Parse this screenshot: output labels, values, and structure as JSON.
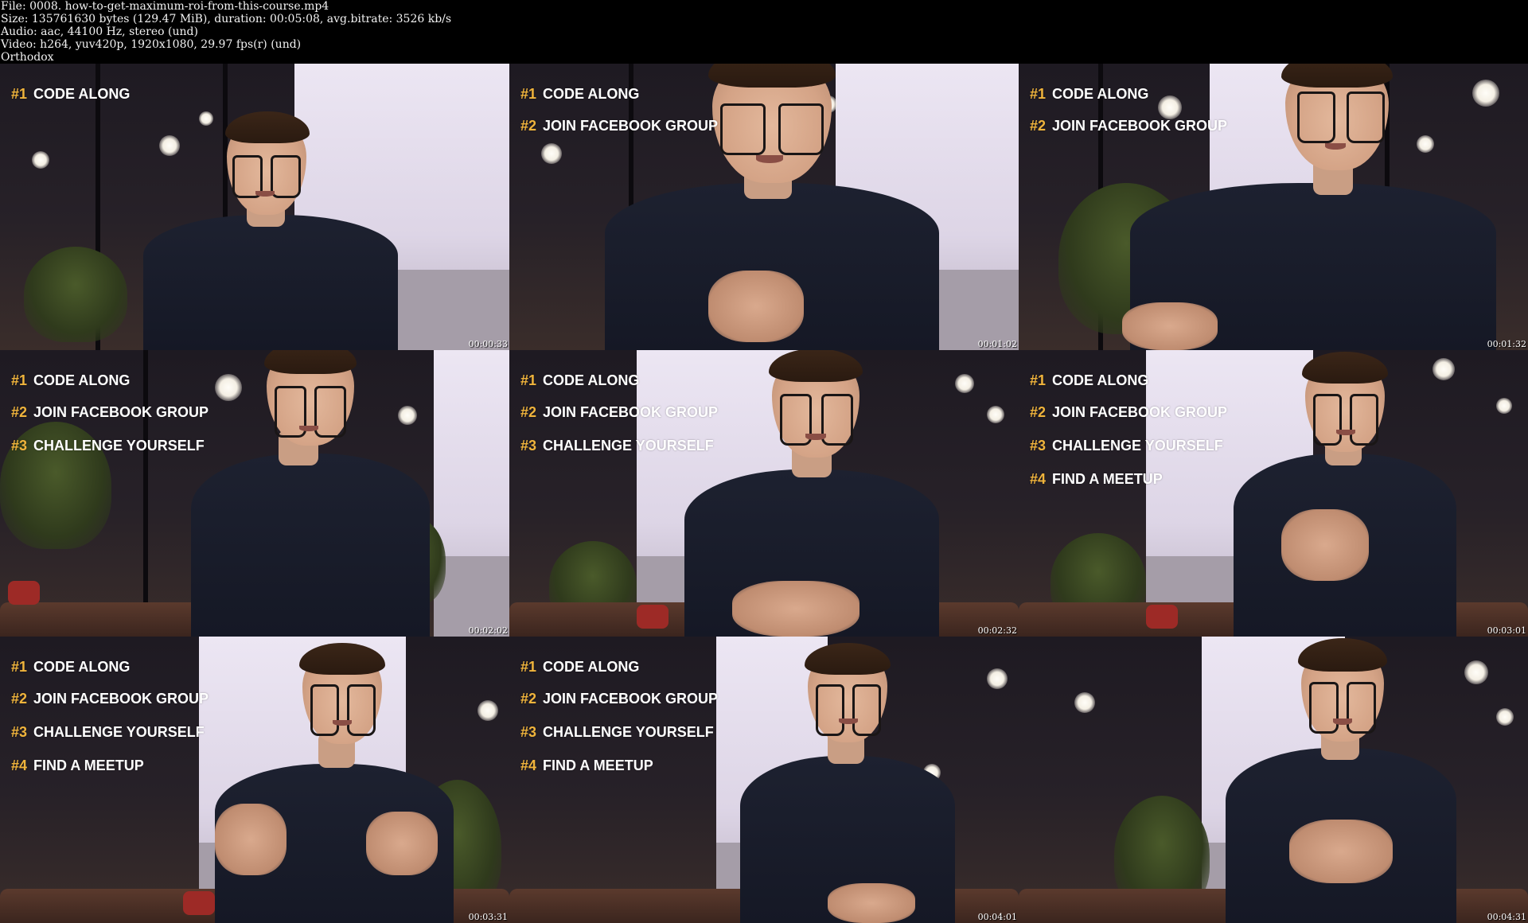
{
  "header": {
    "lines": [
      "File: 0008. how-to-get-maximum-roi-from-this-course.mp4",
      "Size: 135761630 bytes (129.47 MiB), duration: 00:05:08, avg.bitrate: 3526 kb/s",
      "Audio: aac, 44100 Hz, stereo (und)",
      "Video: h264, yuv420p, 1920x1080, 29.97 fps(r) (und)",
      "Orthodox"
    ]
  },
  "colors": {
    "number_accent": "#f0b43c",
    "caption_text": "#ffffff",
    "background": "#000000"
  },
  "frames": [
    {
      "timestamp": "00:00:33",
      "items": [
        {
          "num": "#1",
          "text": "CODE ALONG"
        }
      ]
    },
    {
      "timestamp": "00:01:02",
      "items": [
        {
          "num": "#1",
          "text": "CODE ALONG"
        },
        {
          "num": "#2",
          "text": "JOIN FACEBOOK GROUP"
        }
      ]
    },
    {
      "timestamp": "00:01:32",
      "items": [
        {
          "num": "#1",
          "text": "CODE ALONG"
        },
        {
          "num": "#2",
          "text": "JOIN FACEBOOK GROUP"
        }
      ]
    },
    {
      "timestamp": "00:02:02",
      "items": [
        {
          "num": "#1",
          "text": "CODE ALONG"
        },
        {
          "num": "#2",
          "text": "JOIN FACEBOOK GROUP"
        },
        {
          "num": "#3",
          "text": "CHALLENGE YOURSELF"
        }
      ]
    },
    {
      "timestamp": "00:02:32",
      "items": [
        {
          "num": "#1",
          "text": "CODE ALONG"
        },
        {
          "num": "#2",
          "text": "JOIN FACEBOOK GROUP"
        },
        {
          "num": "#3",
          "text": "CHALLENGE YOURSELF"
        }
      ]
    },
    {
      "timestamp": "00:03:01",
      "items": [
        {
          "num": "#1",
          "text": "CODE ALONG"
        },
        {
          "num": "#2",
          "text": "JOIN FACEBOOK GROUP"
        },
        {
          "num": "#3",
          "text": "CHALLENGE YOURSELF"
        },
        {
          "num": "#4",
          "text": "FIND A MEETUP"
        }
      ]
    },
    {
      "timestamp": "00:03:31",
      "items": [
        {
          "num": "#1",
          "text": "CODE ALONG"
        },
        {
          "num": "#2",
          "text": "JOIN FACEBOOK GROUP"
        },
        {
          "num": "#3",
          "text": "CHALLENGE YOURSELF"
        },
        {
          "num": "#4",
          "text": "FIND A MEETUP"
        }
      ]
    },
    {
      "timestamp": "00:04:01",
      "items": [
        {
          "num": "#1",
          "text": "CODE ALONG"
        },
        {
          "num": "#2",
          "text": "JOIN FACEBOOK GROUP"
        },
        {
          "num": "#3",
          "text": "CHALLENGE YOURSELF"
        },
        {
          "num": "#4",
          "text": "FIND A MEETUP"
        }
      ]
    },
    {
      "timestamp": "00:04:31",
      "items": []
    }
  ]
}
